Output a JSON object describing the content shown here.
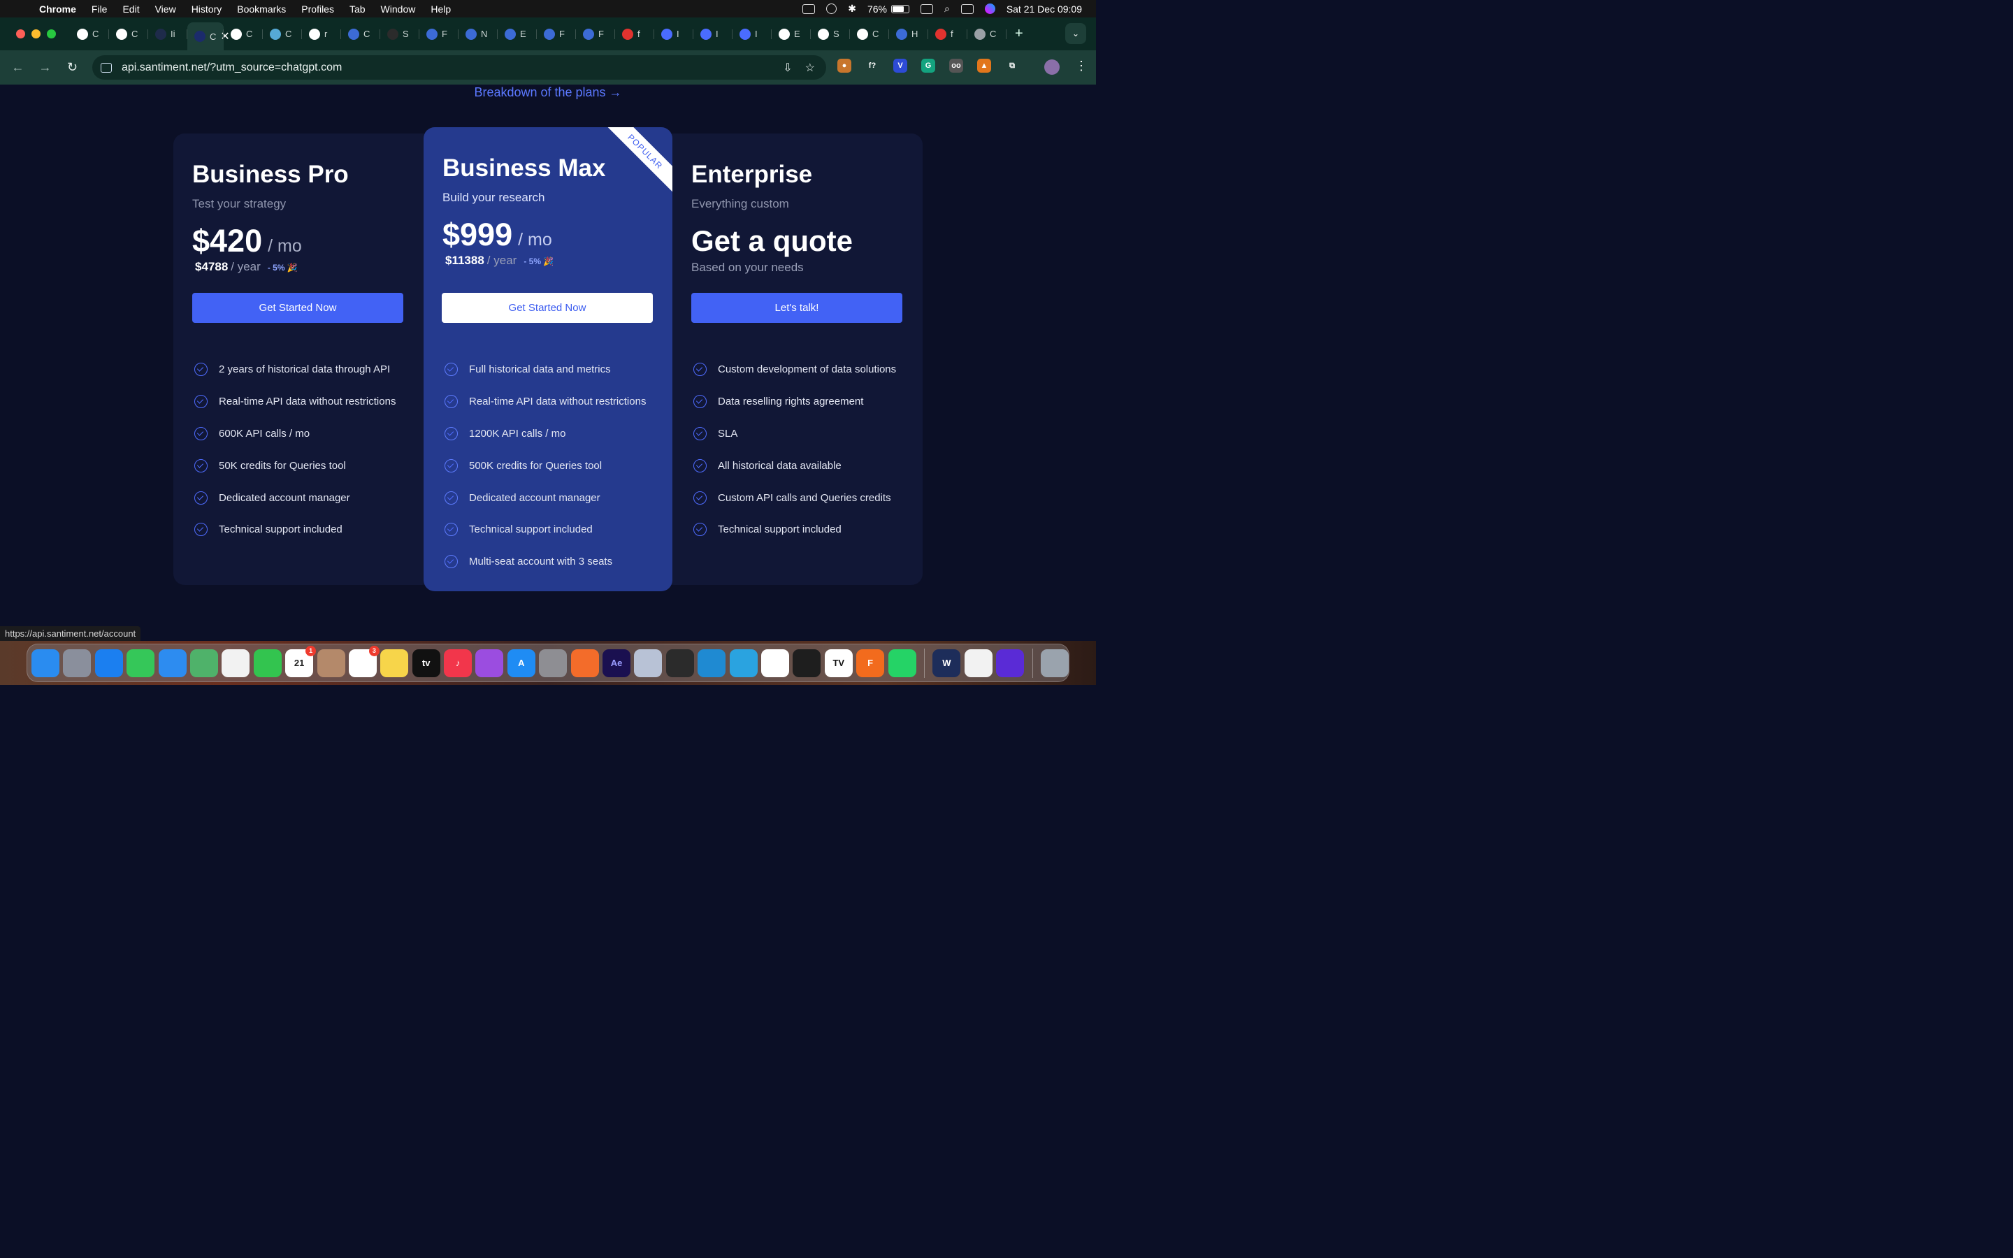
{
  "menubar": {
    "app": "Chrome",
    "items": [
      "File",
      "Edit",
      "View",
      "History",
      "Bookmarks",
      "Profiles",
      "Tab",
      "Window",
      "Help"
    ],
    "battery": "76%",
    "battery_level": 0.76,
    "datetime": "Sat 21 Dec  09:09"
  },
  "tabs": {
    "items": [
      {
        "label": "C",
        "icon": "openai-icon",
        "color": "#ffffff"
      },
      {
        "label": "C",
        "icon": "openai-icon",
        "color": "#ffffff"
      },
      {
        "label": "Ii",
        "icon": "dark-site-icon",
        "color": "#1e2b4a"
      },
      {
        "label": "C",
        "icon": "santiment-icon",
        "color": "#1b2b6b",
        "active": true
      },
      {
        "label": "C",
        "icon": "s-logo-icon",
        "color": "#ffffff"
      },
      {
        "label": "C",
        "icon": "ai-icon",
        "color": "#56a9d6"
      },
      {
        "label": "r",
        "icon": "github-icon",
        "color": "#ffffff"
      },
      {
        "label": "C",
        "icon": "santiment-icon",
        "color": "#3c6bd6"
      },
      {
        "label": "S",
        "icon": "dark-site-icon",
        "color": "#2b2b2b"
      },
      {
        "label": "F",
        "icon": "santiment-icon",
        "color": "#3c6bd6"
      },
      {
        "label": "N",
        "icon": "santiment-icon",
        "color": "#3c6bd6"
      },
      {
        "label": "E",
        "icon": "santiment-icon",
        "color": "#3c6bd6"
      },
      {
        "label": "F",
        "icon": "santiment-icon",
        "color": "#3c6bd6"
      },
      {
        "label": "F",
        "icon": "santiment-icon",
        "color": "#3c6bd6"
      },
      {
        "label": "f",
        "icon": "n-icon",
        "color": "#e0332f"
      },
      {
        "label": "I",
        "icon": "dot-icon",
        "color": "#4a6cff"
      },
      {
        "label": "I",
        "icon": "dot-icon",
        "color": "#4a6cff"
      },
      {
        "label": "I",
        "icon": "dot-icon",
        "color": "#4a6cff"
      },
      {
        "label": "E",
        "icon": "github-icon",
        "color": "#ffffff"
      },
      {
        "label": "S",
        "icon": "github-icon",
        "color": "#ffffff"
      },
      {
        "label": "C",
        "icon": "google-icon",
        "color": "#ffffff"
      },
      {
        "label": "H",
        "icon": "santiment-icon",
        "color": "#3c6bd6"
      },
      {
        "label": "f",
        "icon": "n-icon",
        "color": "#e0332f"
      },
      {
        "label": "C",
        "icon": "globe-icon",
        "color": "#9aa0a6"
      }
    ],
    "active_close": "✕",
    "new_tab": "+"
  },
  "toolbar": {
    "url": "api.santiment.net/?utm_source=chatgpt.com",
    "extensions": [
      {
        "icon": "cookie-icon",
        "color": "#c8762c",
        "glyph": "●"
      },
      {
        "icon": "formula-icon",
        "color": "#1d3f38",
        "glyph": "f?"
      },
      {
        "icon": "v-icon",
        "color": "#2d4bd6",
        "glyph": "V"
      },
      {
        "icon": "grammarly-icon",
        "color": "#14a37f",
        "glyph": "G"
      },
      {
        "icon": "glasses-icon",
        "color": "#555555",
        "glyph": "oo"
      },
      {
        "icon": "metamask-icon",
        "color": "#e2761b",
        "glyph": "▲"
      },
      {
        "icon": "puzzle-icon",
        "color": "#1d3f38",
        "glyph": "⧉"
      }
    ]
  },
  "page": {
    "breakdown_link": "Breakdown of the plans →",
    "plans": {
      "pro": {
        "title": "Business Pro",
        "subtitle": "Test your strategy",
        "price": "$420",
        "per": "/ mo",
        "yearly_price": "$4788",
        "yearly_unit": "/ year",
        "discount": "- 5%",
        "cta": "Get Started Now",
        "features": [
          "2 years of historical data through API",
          "Real-time API data without restrictions",
          "600K API calls / mo",
          "50K credits for Queries tool",
          "Dedicated account manager",
          "Technical support included"
        ]
      },
      "max": {
        "title": "Business Max",
        "subtitle": "Build your research",
        "badge": "POPULAR",
        "price": "$999",
        "per": "/ mo",
        "yearly_price": "$11388",
        "yearly_unit": "/ year",
        "discount": "- 5%",
        "cta": "Get Started Now",
        "features": [
          "Full historical data and metrics",
          "Real-time API data without restrictions",
          "1200K API calls / mo",
          "500K credits for Queries tool",
          "Dedicated account manager",
          "Technical support included",
          "Multi-seat account with 3 seats"
        ]
      },
      "enterprise": {
        "title": "Enterprise",
        "subtitle": "Everything custom",
        "quote": "Get a quote",
        "quote_sub": "Based on your needs",
        "cta": "Let's talk!",
        "features": [
          "Custom development of data solutions",
          "Data reselling rights agreement",
          "SLA",
          "All historical data available",
          "Custom API calls and Queries credits",
          "Technical support included"
        ]
      }
    }
  },
  "status_url": "https://api.santiment.net/account",
  "dock": {
    "apps": [
      {
        "name": "finder",
        "color": "#2a8cf0",
        "glyph": ""
      },
      {
        "name": "launchpad",
        "color": "#8a8f9c",
        "glyph": ""
      },
      {
        "name": "safari",
        "color": "#1b7ff0",
        "glyph": ""
      },
      {
        "name": "messages",
        "color": "#35c759",
        "glyph": ""
      },
      {
        "name": "mail",
        "color": "#2d8cf0",
        "glyph": ""
      },
      {
        "name": "maps",
        "color": "#4fb26a",
        "glyph": ""
      },
      {
        "name": "photos",
        "color": "#f2f2f2",
        "glyph": ""
      },
      {
        "name": "facetime",
        "color": "#33c44f",
        "glyph": ""
      },
      {
        "name": "calendar",
        "color": "#ffffff",
        "glyph": "21",
        "badge": "1",
        "text_color": "#222222"
      },
      {
        "name": "contacts",
        "color": "#b4896a",
        "glyph": ""
      },
      {
        "name": "reminders",
        "color": "#ffffff",
        "glyph": "",
        "badge": "3"
      },
      {
        "name": "notes",
        "color": "#f7d54a",
        "glyph": ""
      },
      {
        "name": "apple-tv",
        "color": "#111111",
        "glyph": "tv"
      },
      {
        "name": "music",
        "color": "#f2364b",
        "glyph": "♪"
      },
      {
        "name": "podcasts",
        "color": "#9b4de0",
        "glyph": ""
      },
      {
        "name": "app-store",
        "color": "#1f8cf4",
        "glyph": "A"
      },
      {
        "name": "system-settings",
        "color": "#8e8e93",
        "glyph": ""
      },
      {
        "name": "pen-app",
        "color": "#f36c2a",
        "glyph": ""
      },
      {
        "name": "after-effects",
        "color": "#1a1050",
        "glyph": "Ae",
        "text_color": "#9a9dff"
      },
      {
        "name": "settings-gear",
        "color": "#b8c2d6",
        "glyph": ""
      },
      {
        "name": "claquette",
        "color": "#2b2b2b",
        "glyph": ""
      },
      {
        "name": "vscode",
        "color": "#1f8ad2",
        "glyph": ""
      },
      {
        "name": "telegram",
        "color": "#2aa3e0",
        "glyph": ""
      },
      {
        "name": "slack",
        "color": "#ffffff",
        "glyph": ""
      },
      {
        "name": "figma",
        "color": "#1e1e1e",
        "glyph": ""
      },
      {
        "name": "tradingview",
        "color": "#ffffff",
        "glyph": "TV",
        "text_color": "#111111"
      },
      {
        "name": "fus-app",
        "color": "#f26b1d",
        "glyph": "F"
      },
      {
        "name": "whatsapp",
        "color": "#25d366",
        "glyph": ""
      },
      {
        "sep": true
      },
      {
        "name": "w-app",
        "color": "#1d2d5a",
        "glyph": "W"
      },
      {
        "name": "chrome",
        "color": "#f2f2f2",
        "glyph": ""
      },
      {
        "name": "arc-app",
        "color": "#5a2bd6",
        "glyph": ""
      },
      {
        "sep": true
      },
      {
        "name": "trash",
        "color": "#9aa3ad",
        "glyph": ""
      }
    ]
  }
}
